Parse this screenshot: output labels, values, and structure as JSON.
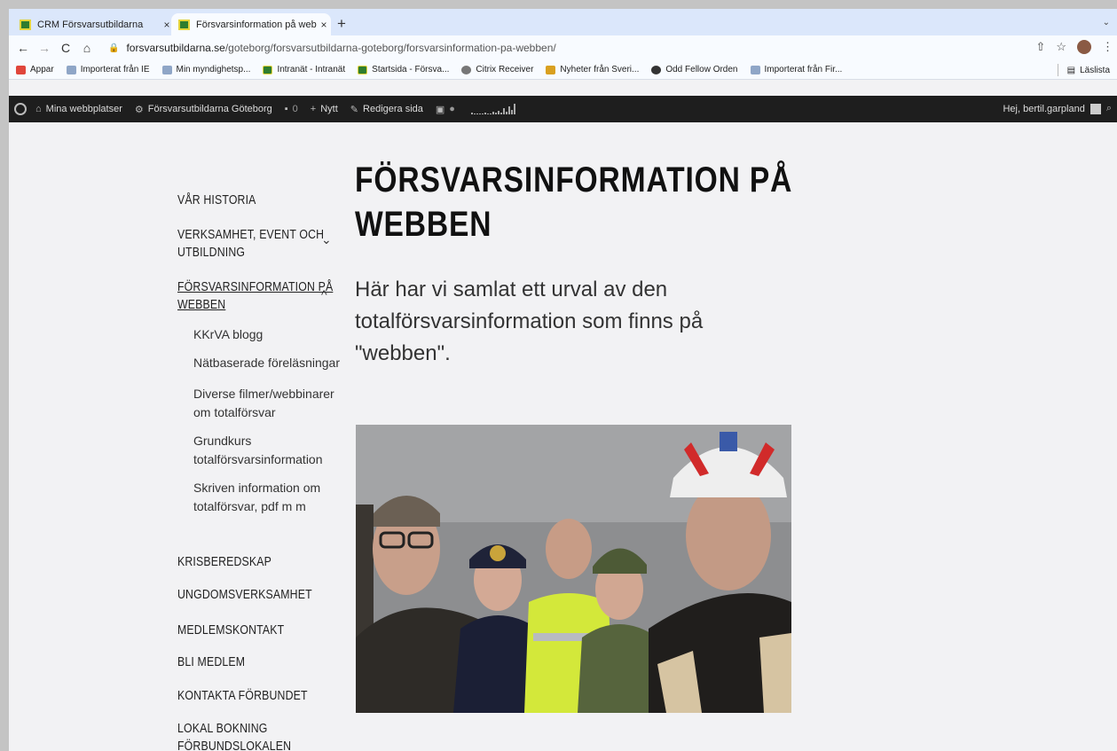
{
  "browser": {
    "tabs": [
      {
        "title": "CRM Försvarsutbildarna",
        "close": "×"
      },
      {
        "title": "Försvarsinformation på webben",
        "close": "×"
      }
    ],
    "new_tab": "+",
    "tab_menu": "⌄",
    "nav": {
      "back": "←",
      "forward": "→",
      "reload": "C",
      "home": "⌂"
    },
    "url_host": "forsvarsutbildarna.se",
    "url_path": "/goteborg/forsvarsutbildarna-goteborg/forsvarsinformation-pa-webben/",
    "toolbar_icons": {
      "share": "⇧",
      "star": "☆",
      "menu": "⋮"
    },
    "bookmarks": [
      {
        "label": "Appar",
        "icon": "apps-grid-icon"
      },
      {
        "label": "Importerat från IE",
        "icon": "folder-icon"
      },
      {
        "label": "Min myndighetsp...",
        "icon": "page-icon"
      },
      {
        "label": "Intranät - Intranät",
        "icon": "gov-crest-icon"
      },
      {
        "label": "Startsida - Försva...",
        "icon": "gov-crest-icon"
      },
      {
        "label": "Citrix Receiver",
        "icon": "citrix-icon"
      },
      {
        "label": "Nyheter från Sveri...",
        "icon": "news-icon"
      },
      {
        "label": "Odd Fellow Orden",
        "icon": "globe-icon"
      },
      {
        "label": "Importerat från Fir...",
        "icon": "folder-icon"
      }
    ],
    "reading_list": "Läslista"
  },
  "admin_bar": {
    "my_sites": "Mina webbplatser",
    "site_name": "Försvarsutbildarna Göteborg",
    "comments_count": "0",
    "new_label": "Nytt",
    "edit_label": "Redigera sida",
    "greeting": "Hej, bertil.garpland"
  },
  "sidebar": {
    "items": [
      {
        "label": "Vår historia"
      },
      {
        "label": "Verksamhet, event och",
        "label2": "utbildning",
        "chevron": "⌄"
      },
      {
        "label": "Försvarsinformation på",
        "label2": "webben",
        "chevron": "^"
      },
      {
        "label": "Krisberedskap"
      },
      {
        "label": "Ungdomsverksamhet"
      },
      {
        "label": "Medlemskontakt"
      },
      {
        "label": "Bli medlem"
      },
      {
        "label": "Kontakta förbundet"
      },
      {
        "label": "Lokal bokning",
        "label2": "förbundslokalen"
      }
    ],
    "subitems": [
      {
        "line1": "KKrVA blogg"
      },
      {
        "line1": "Nätbaserade föreläsningar"
      },
      {
        "line1": "Diverse filmer/webbinarer",
        "line2": "om totalförsvar"
      },
      {
        "line1": "Grundkurs",
        "line2": "totalförsvarsinformation"
      },
      {
        "line1": "Skriven information om",
        "line2": "totalförsvar, pdf m m"
      }
    ]
  },
  "main": {
    "title_line1": "Försvarsinformation på",
    "title_line2": "webben",
    "lead": "Här har vi samlat ett urval av den totalförsvarsinformation som finns på \"webben\"."
  }
}
